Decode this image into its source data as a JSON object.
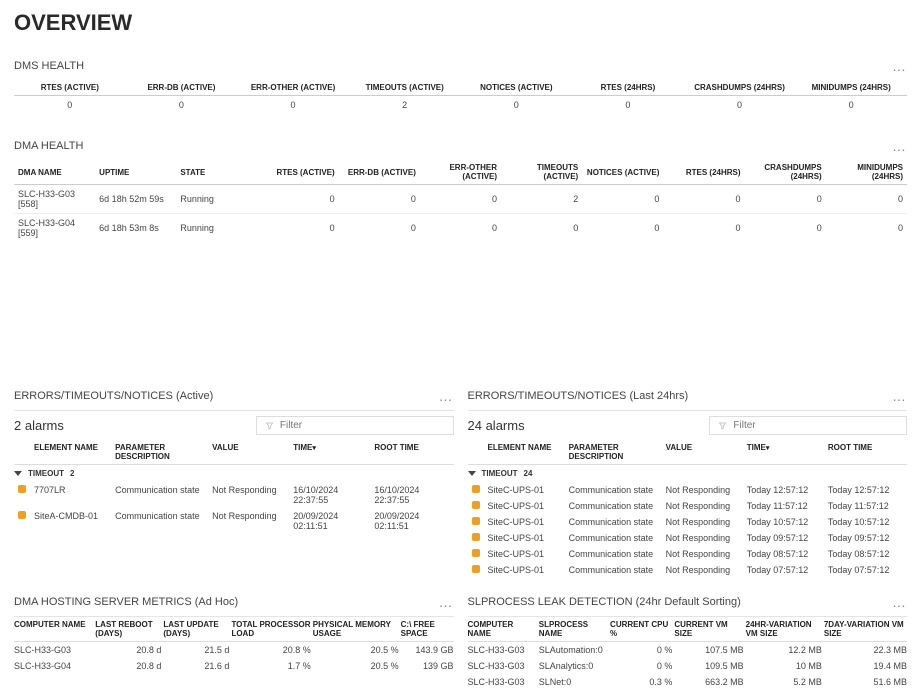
{
  "page_title": "OVERVIEW",
  "dms_health": {
    "title": "DMS HEALTH",
    "dots": "…",
    "headers": [
      "RTES (ACTIVE)",
      "ERR-DB (ACTIVE)",
      "ERR-OTHER (ACTIVE)",
      "TIMEOUTS (ACTIVE)",
      "NOTICES (ACTIVE)",
      "RTES (24HRS)",
      "CRASHDUMPS (24HRS)",
      "MINIDUMPS (24HRS)"
    ],
    "values": [
      "0",
      "0",
      "0",
      "2",
      "0",
      "0",
      "0",
      "0"
    ]
  },
  "dma_health": {
    "title": "DMA HEALTH",
    "dots": "…",
    "headers": [
      "DMA NAME",
      "UPTIME",
      "STATE",
      "RTES (ACTIVE)",
      "ERR-DB (ACTIVE)",
      "ERR-OTHER (ACTIVE)",
      "TIMEOUTS (ACTIVE)",
      "NOTICES (ACTIVE)",
      "RTES (24HRS)",
      "CRASHDUMPS (24HRS)",
      "MINIDUMPS (24HRS)"
    ],
    "rows": [
      {
        "name": "SLC-H33-G03 [558]",
        "uptime": "6d 18h 52m 59s",
        "state": "Running",
        "vals": [
          "0",
          "0",
          "0",
          "2",
          "0",
          "0",
          "0",
          "0"
        ]
      },
      {
        "name": "SLC-H33-G04 [559]",
        "uptime": "6d 18h 53m 8s",
        "state": "Running",
        "vals": [
          "0",
          "0",
          "0",
          "0",
          "0",
          "0",
          "0",
          "0"
        ]
      }
    ]
  },
  "errors_active": {
    "title": "ERRORS/TIMEOUTS/NOTICES (Active)",
    "dots": "…",
    "alarms_label": "2 alarms",
    "filter_placeholder": "Filter",
    "headers": [
      "ELEMENT NAME",
      "PARAMETER DESCRIPTION",
      "VALUE",
      "TIME",
      "ROOT TIME"
    ],
    "sort_col": "TIME",
    "group_label": "TIMEOUT",
    "group_count": "2",
    "rows": [
      {
        "element": "7707LR",
        "param": "Communication state",
        "value": "Not Responding",
        "time": "16/10/2024 22:37:55",
        "root": "16/10/2024 22:37:55"
      },
      {
        "element": "SiteA-CMDB-01",
        "param": "Communication state",
        "value": "Not Responding",
        "time": "20/09/2024 02:11:51",
        "root": "20/09/2024 02:11:51"
      }
    ]
  },
  "errors_24h": {
    "title": "ERRORS/TIMEOUTS/NOTICES (Last 24hrs)",
    "dots": "…",
    "alarms_label": "24 alarms",
    "filter_placeholder": "Filter",
    "headers": [
      "ELEMENT NAME",
      "PARAMETER DESCRIPTION",
      "VALUE",
      "TIME",
      "ROOT TIME"
    ],
    "sort_col": "TIME",
    "group_label": "TIMEOUT",
    "group_count": "24",
    "rows": [
      {
        "element": "SiteC-UPS-01",
        "param": "Communication state",
        "value": "Not Responding",
        "time": "Today 12:57:12",
        "root": "Today 12:57:12"
      },
      {
        "element": "SiteC-UPS-01",
        "param": "Communication state",
        "value": "Not Responding",
        "time": "Today 11:57:12",
        "root": "Today 11:57:12"
      },
      {
        "element": "SiteC-UPS-01",
        "param": "Communication state",
        "value": "Not Responding",
        "time": "Today 10:57:12",
        "root": "Today 10:57:12"
      },
      {
        "element": "SiteC-UPS-01",
        "param": "Communication state",
        "value": "Not Responding",
        "time": "Today 09:57:12",
        "root": "Today 09:57:12"
      },
      {
        "element": "SiteC-UPS-01",
        "param": "Communication state",
        "value": "Not Responding",
        "time": "Today 08:57:12",
        "root": "Today 08:57:12"
      },
      {
        "element": "SiteC-UPS-01",
        "param": "Communication state",
        "value": "Not Responding",
        "time": "Today 07:57:12",
        "root": "Today 07:57:12"
      }
    ]
  },
  "hosting": {
    "title": "DMA HOSTING SERVER METRICS (Ad Hoc)",
    "dots": "…",
    "headers": [
      "COMPUTER NAME",
      "LAST REBOOT (DAYS)",
      "LAST UPDATE (DAYS)",
      "TOTAL PROCESSOR LOAD",
      "PHYSICAL MEMORY USAGE",
      "C:\\ FREE SPACE"
    ],
    "rows": [
      {
        "name": "SLC-H33-G03",
        "reboot": "20.8 d",
        "update": "21.5 d",
        "cpu": "20.8 %",
        "mem": "20.5 %",
        "free": "143.9 GB"
      },
      {
        "name": "SLC-H33-G04",
        "reboot": "20.8 d",
        "update": "21.6 d",
        "cpu": "1.7 %",
        "mem": "20.5 %",
        "free": "139 GB"
      }
    ]
  },
  "leak": {
    "title": "SLPROCESS LEAK DETECTION (24hr Default Sorting)",
    "dots": "…",
    "headers": [
      "COMPUTER NAME",
      "SLPROCESS NAME",
      "CURRENT CPU %",
      "CURRENT VM SIZE",
      "24HR-VARIATION VM SIZE",
      "7DAY-VARIATION VM SIZE"
    ],
    "rows": [
      {
        "cname": "SLC-H33-G03",
        "pname": "SLAutomation:0",
        "cpu": "0 %",
        "vm": "107.5 MB",
        "v24": "12.2 MB",
        "v7": "22.3 MB"
      },
      {
        "cname": "SLC-H33-G03",
        "pname": "SLAnalytics:0",
        "cpu": "0 %",
        "vm": "109.5 MB",
        "v24": "10 MB",
        "v7": "19.4 MB"
      },
      {
        "cname": "SLC-H33-G03",
        "pname": "SLNet:0",
        "cpu": "0.3 %",
        "vm": "663.2 MB",
        "v24": "5.2 MB",
        "v7": "51.6 MB"
      }
    ]
  }
}
